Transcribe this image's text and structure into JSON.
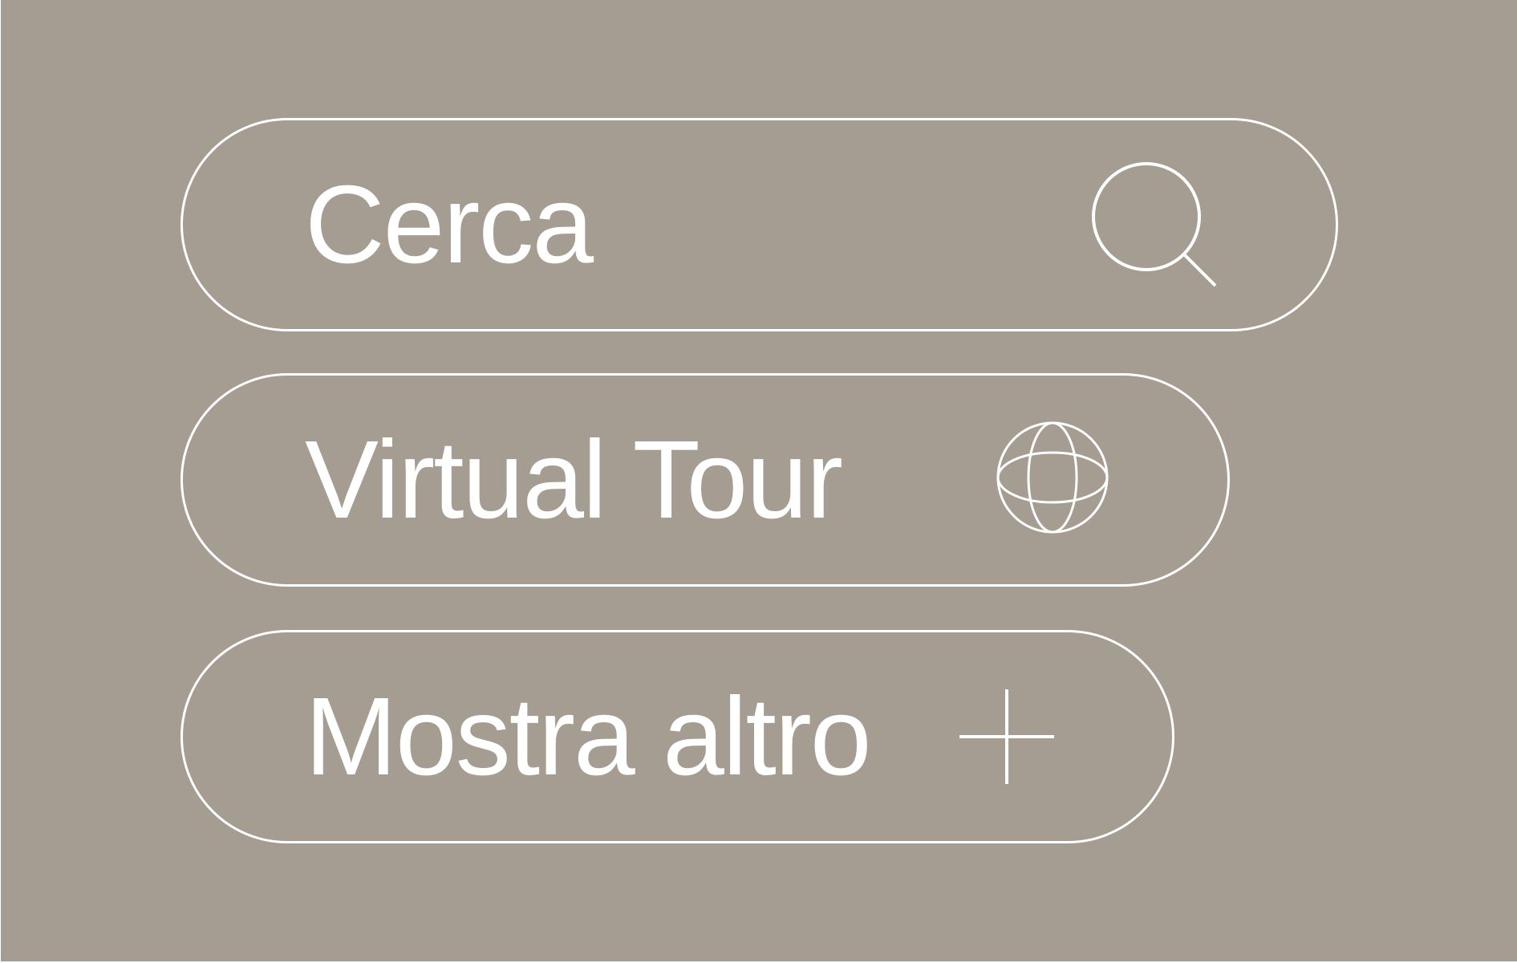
{
  "colors": {
    "background": "#a59c92",
    "foreground": "#ffffff"
  },
  "buttons": [
    {
      "label": "Cerca",
      "icon": "search-icon"
    },
    {
      "label": "Virtual Tour",
      "icon": "globe-icon"
    },
    {
      "label": "Mostra altro",
      "icon": "plus-icon"
    }
  ]
}
